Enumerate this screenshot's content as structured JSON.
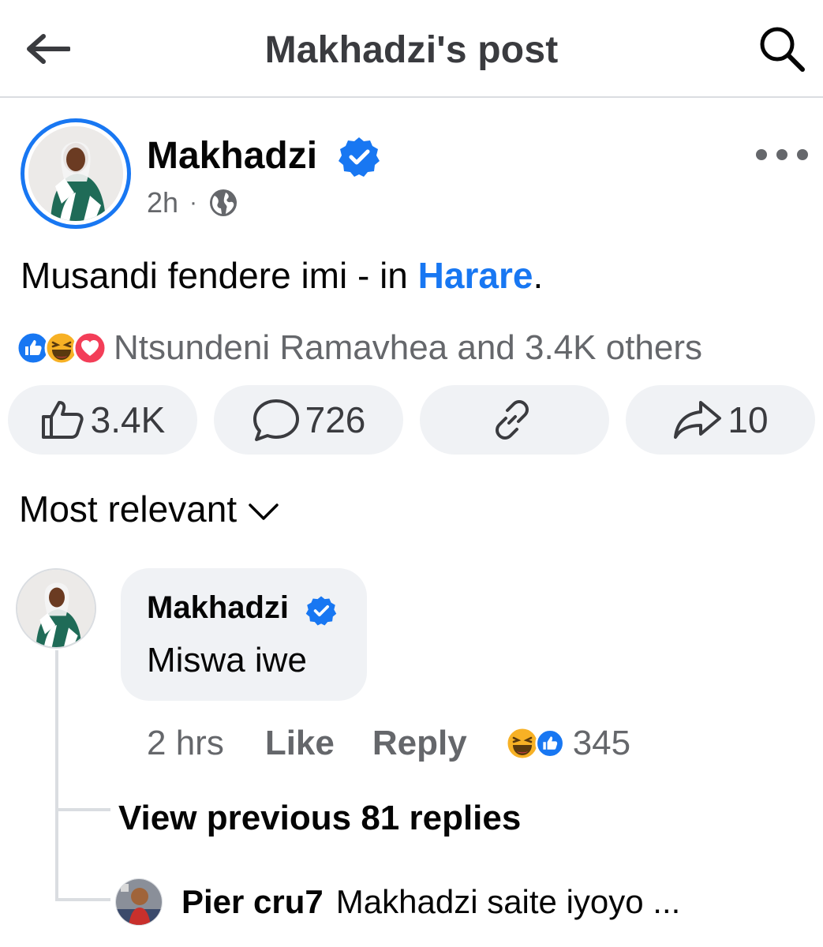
{
  "header": {
    "title": "Makhadzi's post",
    "back_icon": "arrow-left-icon",
    "search_icon": "search-icon"
  },
  "post": {
    "author": "Makhadzi",
    "verified": true,
    "time": "2h",
    "dot": "·",
    "privacy_icon": "globe-icon",
    "text_prefix": "Musandi fendere imi - in ",
    "location": "Harare",
    "text_suffix": ".",
    "reactions": {
      "icons": [
        "like-reaction-icon",
        "haha-reaction-icon",
        "love-reaction-icon"
      ],
      "summary": "Ntsundeni Ramavhea and 3.4K others"
    },
    "actions": {
      "like_count": "3.4K",
      "comment_count": "726",
      "share_count": "10"
    }
  },
  "sort": {
    "label": "Most relevant"
  },
  "comment": {
    "author": "Makhadzi",
    "verified": true,
    "text": "Miswa iwe",
    "time": "2 hrs",
    "like_label": "Like",
    "reply_label": "Reply",
    "reaction_count": "345",
    "view_previous": "View previous 81 replies"
  },
  "reply": {
    "author": "Pier cru7",
    "text": "Makhadzi saite iyoyo ..."
  },
  "colors": {
    "accent": "#1877f2",
    "secondary_text": "#65676b",
    "pill_bg": "#f0f2f5",
    "love": "#f33e58",
    "haha": "#f7b125"
  }
}
